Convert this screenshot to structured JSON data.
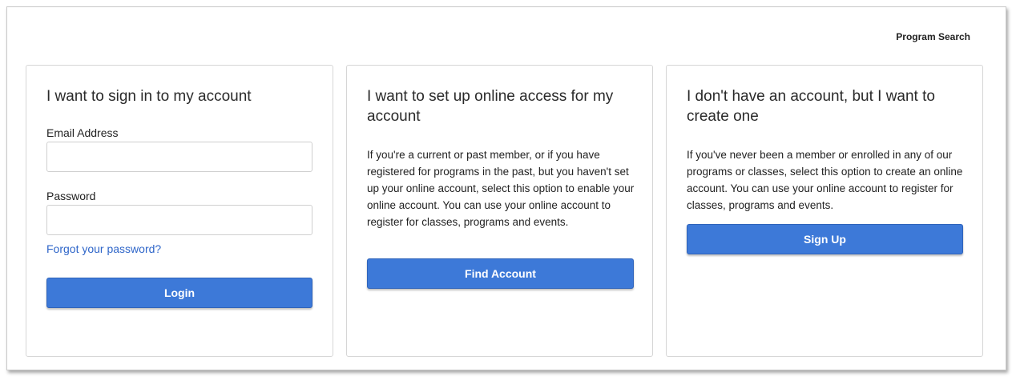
{
  "header": {
    "program_search_label": "Program Search"
  },
  "sign_in": {
    "title": "I want to sign in to my account",
    "email_label": "Email Address",
    "email_value": "",
    "password_label": "Password",
    "password_value": "",
    "forgot_label": "Forgot your password?",
    "login_label": "Login"
  },
  "setup_access": {
    "title": "I want to set up online access for my account",
    "description": "If you're a current or past member, or if you have registered for programs in the past, but you haven't set up your online account, select this option to enable your online account. You can use your online account to register for classes, programs and events.",
    "button_label": "Find Account"
  },
  "create_account": {
    "title": "I don't have an account, but I want to create one",
    "description": "If you've never been a member or enrolled in any of our programs or classes, select this option to create an online account. You can use your online account to register for classes, programs and events.",
    "button_label": "Sign Up"
  },
  "colors": {
    "primary_button": "#3d79d8",
    "link": "#2f66c9",
    "border": "#d6d6d6"
  }
}
